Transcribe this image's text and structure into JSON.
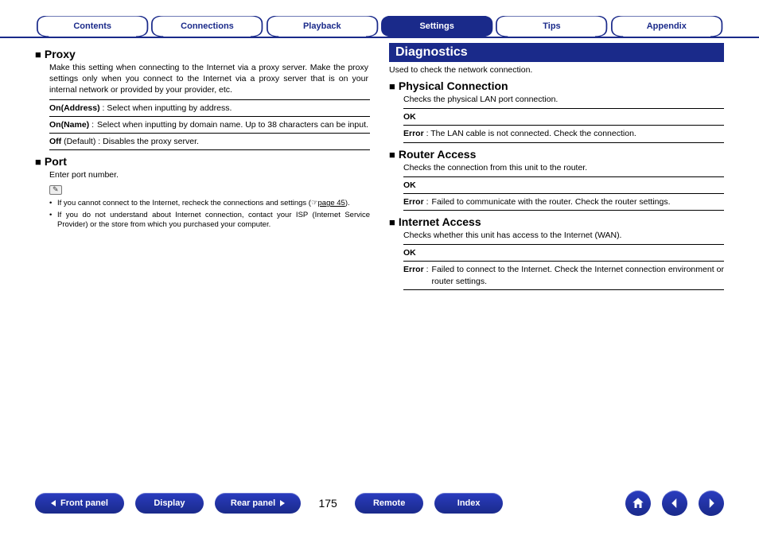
{
  "tabs": {
    "items": [
      {
        "label": "Contents",
        "active": false
      },
      {
        "label": "Connections",
        "active": false
      },
      {
        "label": "Playback",
        "active": false
      },
      {
        "label": "Settings",
        "active": true
      },
      {
        "label": "Tips",
        "active": false
      },
      {
        "label": "Appendix",
        "active": false
      }
    ]
  },
  "left": {
    "proxy": {
      "title": "Proxy",
      "desc": "Make this setting when connecting to the Internet via a proxy server. Make the proxy settings only when you connect to the Internet via a proxy server that is on your internal network or provided by your provider, etc.",
      "rows": [
        {
          "term": "On(Address)",
          "sep": " : ",
          "def": "Select when inputting by address."
        },
        {
          "term": "On(Name)",
          "sep": " : ",
          "def": "Select when inputting by domain name. Up to 38 characters can be input."
        },
        {
          "term": "Off",
          "extra": " (Default) : ",
          "def": "Disables the proxy server."
        }
      ]
    },
    "port": {
      "title": "Port",
      "desc": "Enter port number."
    },
    "notes": [
      {
        "pre": "If you cannot connect to the Internet, recheck the connections and settings (☞",
        "link": "page 45",
        "post": ")."
      },
      {
        "pre": "If you do not understand about Internet connection, contact your ISP (Internet Service Provider) or the store from which you purchased your computer.",
        "link": "",
        "post": ""
      }
    ]
  },
  "right": {
    "page_title": "Diagnostics",
    "page_desc": "Used to check the network connection.",
    "sections": [
      {
        "title": "Physical Connection",
        "desc": "Checks the physical LAN port connection.",
        "rows": [
          {
            "term": "OK",
            "sep": "",
            "def": ""
          },
          {
            "term": "Error",
            "sep": " : ",
            "def": "The LAN cable is not connected. Check the connection."
          }
        ]
      },
      {
        "title": "Router Access",
        "desc": "Checks the connection from this unit to the router.",
        "rows": [
          {
            "term": "OK",
            "sep": "",
            "def": ""
          },
          {
            "term": "Error",
            "sep": " : ",
            "def": "Failed to communicate with the router. Check the router settings."
          }
        ]
      },
      {
        "title": "Internet Access",
        "desc": "Checks whether this unit has access to the Internet (WAN).",
        "rows": [
          {
            "term": "OK",
            "sep": "",
            "def": ""
          },
          {
            "term": "Error",
            "sep": " : ",
            "def": "Failed to connect to the Internet. Check the Internet connection environment or router settings."
          }
        ]
      }
    ]
  },
  "footer": {
    "buttons": [
      "Front panel",
      "Display",
      "Rear panel"
    ],
    "page": "175",
    "buttons2": [
      "Remote",
      "Index"
    ],
    "icons": [
      "home-icon",
      "arrow-left-icon",
      "arrow-right-icon"
    ]
  }
}
